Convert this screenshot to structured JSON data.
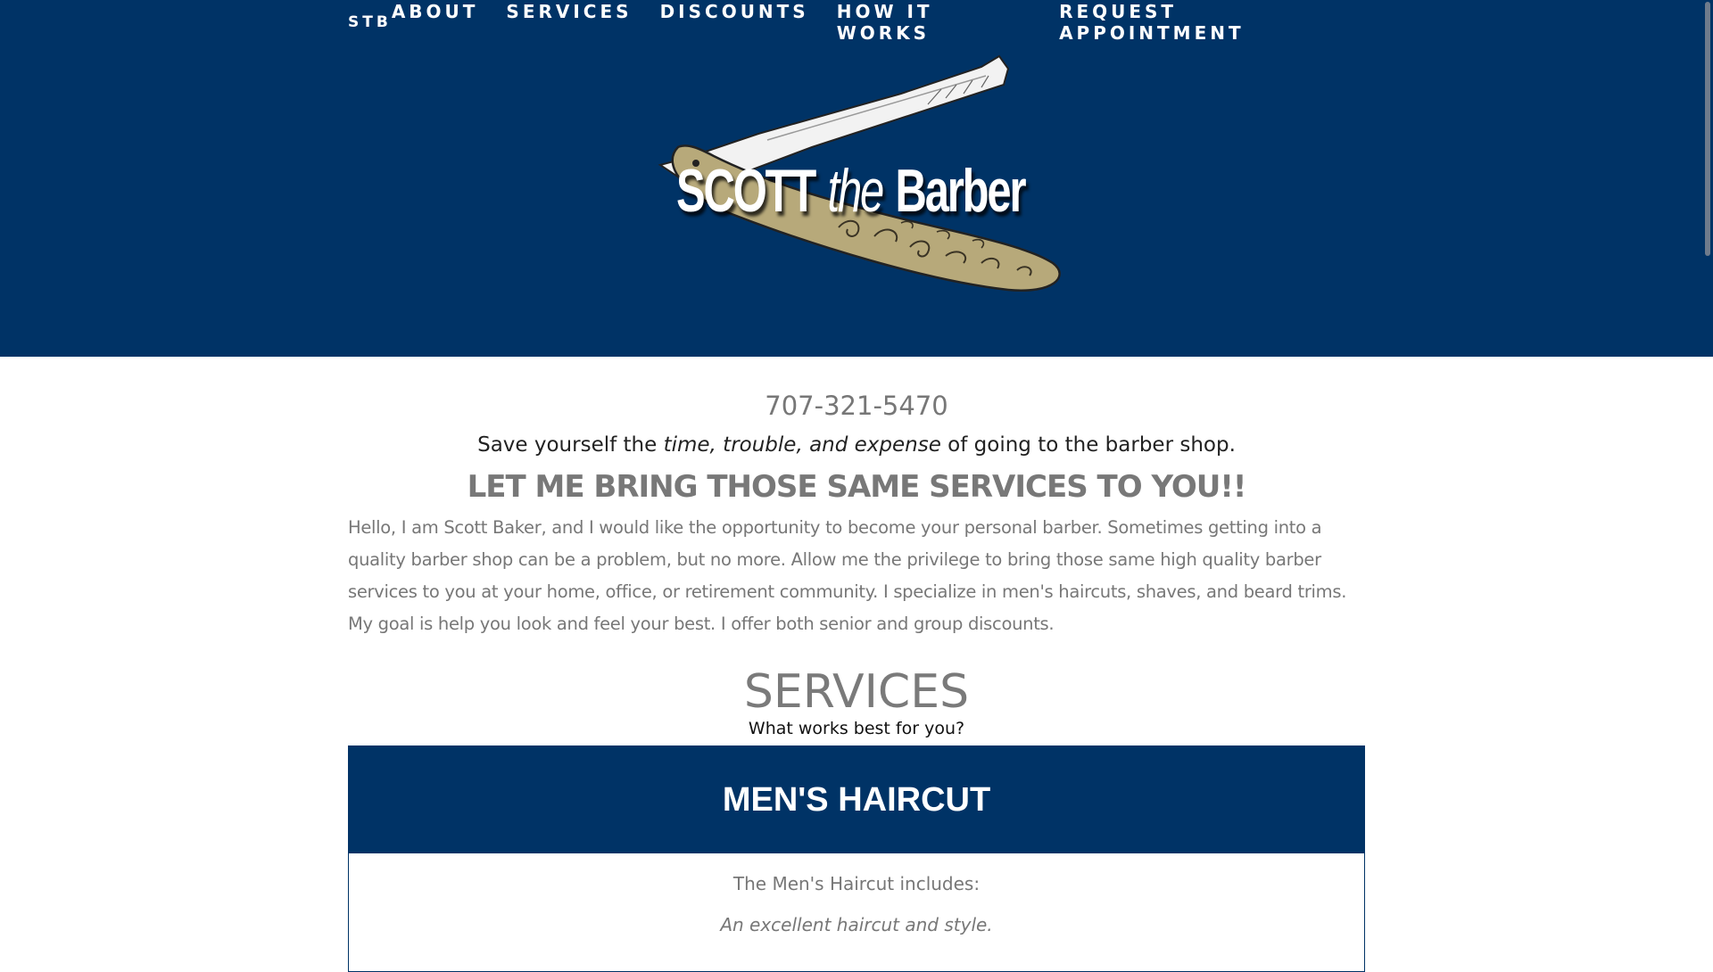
{
  "nav": {
    "brand": "STB",
    "links": [
      "ABOUT",
      "SERVICES",
      "DISCOUNTS",
      "HOW IT WORKS",
      "REQUEST APPOINTMENT"
    ]
  },
  "logo": {
    "word1": "SCOTT",
    "word2": "the",
    "word3": "Barber"
  },
  "contact": {
    "phone": "707-321-5470"
  },
  "tagline": {
    "before": "Save yourself the ",
    "emphasis": "time, trouble, and expense",
    "after": " of going to the barber shop."
  },
  "headline": "LET ME BRING THOSE SAME SERVICES TO YOU!!",
  "intro": "Hello, I am Scott Baker, and I would like the opportunity to become your personal barber. Sometimes getting into a quality barber shop can be a problem, but no more. Allow me the privilege to bring those same high quality barber services to you at your home, office, or retirement community. I specialize in men's haircuts, shaves, and beard trims. My goal is help you look and feel your best. I offer both senior and group discounts.",
  "services": {
    "title": "SERVICES",
    "subtitle": "What works best for you?",
    "card": {
      "title": "MEN'S HAIRCUT",
      "includes": "The Men's Haircut includes:",
      "feature": "An excellent haircut and style."
    }
  },
  "colors": {
    "navy": "#003366",
    "gold": "#b7a97a",
    "gray": "#777777"
  }
}
